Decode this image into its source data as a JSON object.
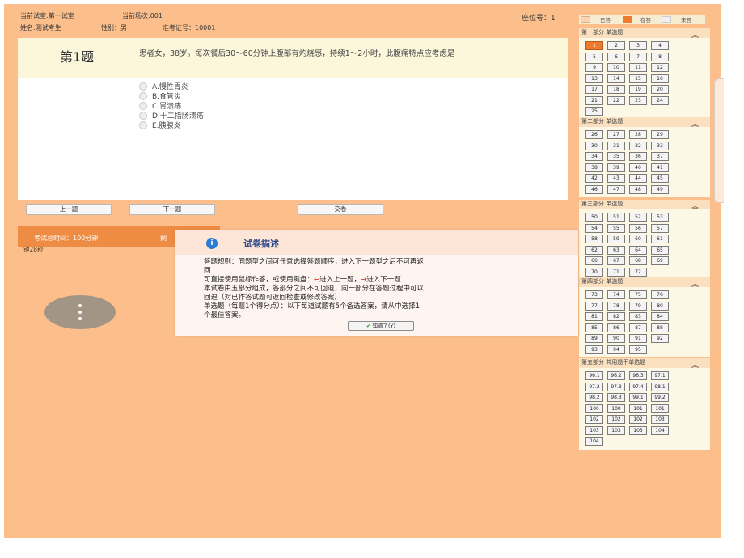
{
  "header": {
    "room": "当前试室:第一试室",
    "session": "当前场次:001",
    "name": "姓名:测试考生",
    "gender": "性别：男",
    "ticket": "准考证号：10001",
    "seat": "座位号：1"
  },
  "question": {
    "number": "第1题",
    "text": "患者女，38岁。每次餐后30～60分钟上腹部有灼烧感，持续1～2小时，此腹痛特点应考虑是",
    "options": [
      "A.慢性胃炎",
      "B.食管炎",
      "C.胃溃疡",
      "D.十二指肠溃疡",
      "E.胰腺炎"
    ]
  },
  "buttons": {
    "prev": "上一题",
    "next": "下一题",
    "submit": "交卷"
  },
  "timer": {
    "total": "考试总时间：100分钟",
    "remaining_label": "剩",
    "remaining_tail": "钟28秒"
  },
  "legend": {
    "answered": "已答",
    "current": "在答",
    "unanswered": "未答"
  },
  "sections": [
    {
      "title": "第一部分 单选题",
      "items": [
        "1",
        "2",
        "3",
        "4",
        "5",
        "6",
        "7",
        "8",
        "9",
        "10",
        "11",
        "12",
        "13",
        "14",
        "15",
        "16",
        "17",
        "18",
        "19",
        "20",
        "21",
        "22",
        "23",
        "24",
        "25"
      ]
    },
    {
      "title": "第二部分 单选题",
      "items": [
        "26",
        "27",
        "28",
        "29",
        "30",
        "31",
        "32",
        "33",
        "34",
        "35",
        "36",
        "37",
        "38",
        "39",
        "40",
        "41",
        "42",
        "43",
        "44",
        "45",
        "46",
        "47",
        "48",
        "49"
      ]
    },
    {
      "title": "第三部分 单选题",
      "items": [
        "50",
        "51",
        "52",
        "53",
        "54",
        "55",
        "56",
        "57",
        "58",
        "59",
        "60",
        "61",
        "62",
        "63",
        "64",
        "65",
        "66",
        "67",
        "68",
        "69",
        "70",
        "71",
        "72"
      ]
    },
    {
      "title": "第四部分 单选题",
      "items": [
        "73",
        "74",
        "75",
        "76",
        "77",
        "78",
        "79",
        "80",
        "81",
        "82",
        "83",
        "84",
        "85",
        "86",
        "87",
        "88",
        "89",
        "90",
        "91",
        "92",
        "93",
        "94",
        "95"
      ]
    },
    {
      "title": "第五部分 共用题干单选题",
      "items": [
        "96.1",
        "96.2",
        "96.3",
        "97.1",
        "97.2",
        "97.3",
        "97.4",
        "98.1",
        "98.2",
        "98.3",
        "99.1",
        "99.2",
        "100",
        "100",
        "101",
        "101",
        "102",
        "102",
        "102",
        "103",
        "103",
        "103",
        "103",
        "104",
        "104"
      ]
    }
  ],
  "current_item": "1",
  "collapse_icon": "double-chevron-up-icon",
  "dialog": {
    "title": "试卷描述",
    "lines": [
      "答题规则：同题型之间可任意选择答题顺序，进入下一题型之后不可再返",
      "回",
      "本试卷由五部分组成，各部分之间不可回退，同一部分在答题过程中可以",
      "回退（对已作答试题可返回检查或修改答案）",
      "单选题（每题1个得分点）：以下每道试题有5个备选答案，请从中选择1",
      "个最佳答案。"
    ],
    "keys": {
      "a": "可直接使用鼠标作答，或使用键盘：",
      "b": "进入上一题，",
      "c": "进入下一题"
    },
    "ok": "知道了(Y)"
  },
  "colors": {
    "background": "#fcbf8c",
    "accent": "#ee7a2e",
    "dialog_title": "#2c4a8a"
  }
}
